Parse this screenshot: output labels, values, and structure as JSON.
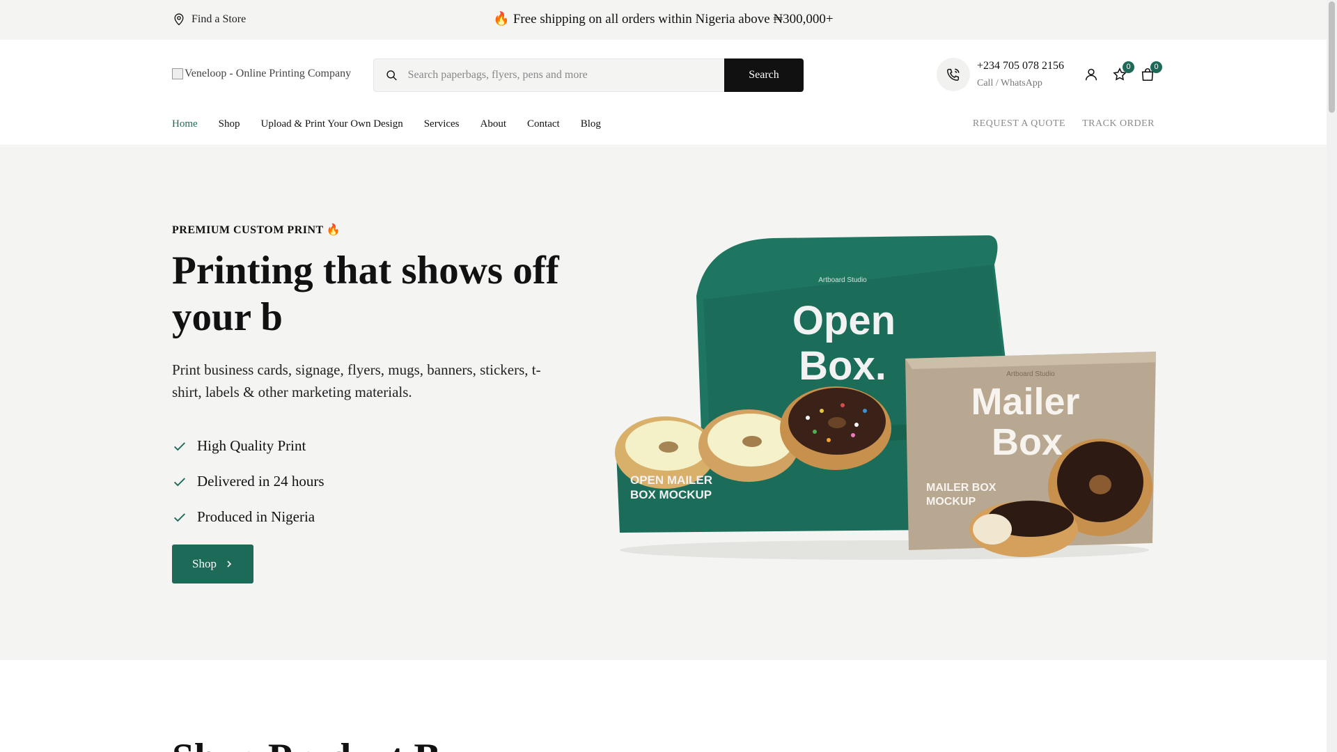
{
  "topbar": {
    "find_store": "Find a Store",
    "announcement": "🔥 Free shipping on all orders within Nigeria above ₦300,000+"
  },
  "header": {
    "logo_alt": "Veneloop - Online Printing Company",
    "search": {
      "placeholder": "Search paperbags, flyers, pens and more",
      "value": "",
      "button": "Search"
    },
    "phone": {
      "number": "+234 705 078 2156",
      "sub": "Call / WhatsApp"
    },
    "wishlist_count": "0",
    "cart_count": "0"
  },
  "nav": {
    "items": [
      {
        "label": "Home"
      },
      {
        "label": "Shop"
      },
      {
        "label": "Upload & Print Your Own Design"
      },
      {
        "label": "Services"
      },
      {
        "label": "About"
      },
      {
        "label": "Contact"
      },
      {
        "label": "Blog"
      }
    ],
    "right": {
      "quote": "REQUEST A QUOTE",
      "track": "TRACK ORDER"
    }
  },
  "hero": {
    "eyebrow": "PREMIUM CUSTOM PRINT 🔥",
    "title": "Printing that shows off your b",
    "description": "Print business cards, signage, flyers, mugs, banners, stickers, t-shirt, labels & other marketing materials.",
    "features": [
      "High Quality Print",
      "Delivered in 24 hours",
      "Produced in Nigeria"
    ],
    "cta": "Shop",
    "image": {
      "green_box_brand": "Artboard Studio",
      "green_box_lid_text": "Open Box.",
      "green_box_label": "OPEN MAILER BOX MOCKUP",
      "kraft_box_brand": "Artboard Studio",
      "kraft_box_text": "Mailer Box",
      "kraft_box_label": "MAILER BOX MOCKUP"
    }
  },
  "next_section": {
    "title": "Shop Product By"
  },
  "colors": {
    "accent": "#1d6a58",
    "bar_bg": "#f4f4f3",
    "dark": "#111111"
  }
}
